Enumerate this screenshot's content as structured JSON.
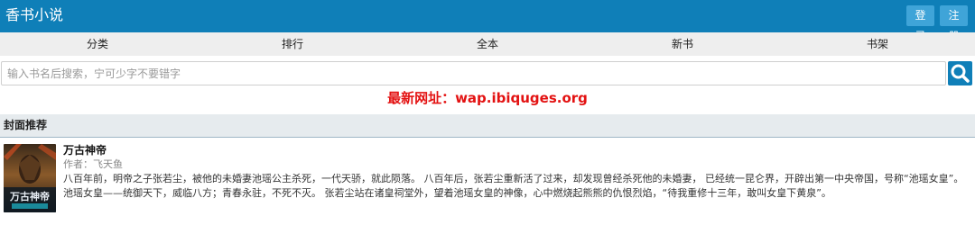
{
  "header": {
    "site_title": "香书小说",
    "login_label": "登录",
    "register_label": "注册"
  },
  "nav": {
    "items": [
      "分类",
      "排行",
      "全本",
      "新书",
      "书架"
    ]
  },
  "search": {
    "placeholder": "输入书名后搜索，宁可少字不要错字",
    "button_icon": "search-icon"
  },
  "notice": {
    "text": "最新网址：wap.ibiquges.org"
  },
  "section": {
    "title": "封面推荐"
  },
  "book": {
    "title": "万古神帝",
    "author": "作者：飞天鱼",
    "cover_text": "万古神帝",
    "description": "八百年前，明帝之子张若尘，被他的未婚妻池瑶公主杀死，一代天骄，就此陨落。 八百年后，张若尘重新活了过来，却发现曾经杀死他的未婚妻， 已经统一昆仑界，开辟出第一中央帝国，号称“池瑶女皇”。 池瑶女皇——统御天下，威临八方；青春永驻，不死不灭。 张若尘站在诸皇祠堂外，望着池瑶女皇的神像，心中燃烧起熊熊的仇恨烈焰，“待我重修十三年，敢叫女皇下黄泉”。"
  },
  "colors": {
    "header_bg": "#0f7fb8",
    "button_bg": "#3fa4d8",
    "notice": "#e31212",
    "nav_bg": "#eeeeee",
    "section_bg": "#e6ebee"
  }
}
